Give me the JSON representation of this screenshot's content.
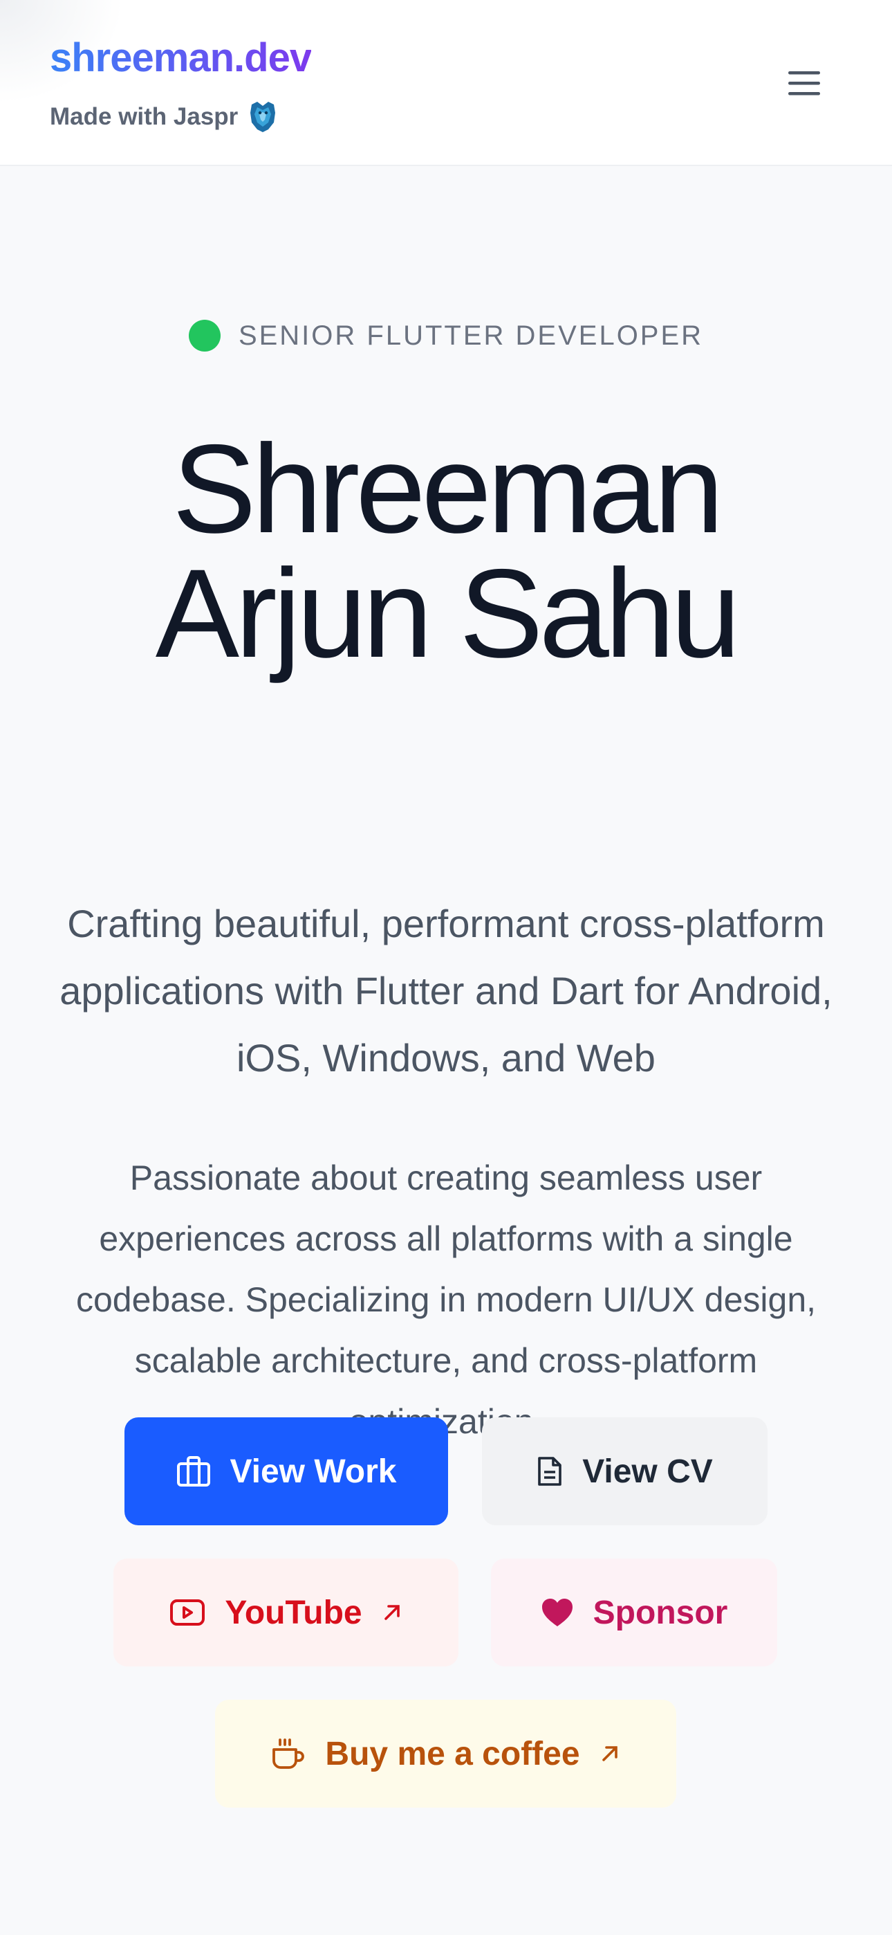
{
  "header": {
    "brand": "shreeman.dev",
    "made_with": "Made with Jaspr"
  },
  "hero": {
    "role": "SENIOR FLUTTER DEVELOPER",
    "name": "Shreeman Arjun Sahu",
    "tagline": "Crafting beautiful, performant cross-platform applications with Flutter and Dart for Android, iOS, Windows, and Web",
    "bio": "Passionate about creating seamless user experiences across all platforms with a single codebase. Specializing in modern UI/UX design, scalable architecture, and cross-platform optimization."
  },
  "actions": {
    "view_work": "View Work",
    "view_cv": "View CV",
    "youtube": "YouTube",
    "sponsor": "Sponsor",
    "coffee": "Buy me a coffee"
  },
  "colors": {
    "brand_gradient_start": "#3b82f6",
    "brand_gradient_end": "#7c3aed",
    "status_dot": "#22c55e",
    "primary_button": "#1a5cff",
    "youtube": "#d70f1c",
    "sponsor": "#c1175c",
    "coffee": "#b8520c"
  },
  "icons": {
    "menu": "hamburger-icon",
    "jaspr": "jaspr-logo-icon",
    "view_work": "briefcase-icon",
    "view_cv": "document-icon",
    "youtube": "youtube-icon",
    "external": "arrow-up-right-icon",
    "sponsor": "heart-icon",
    "coffee": "coffee-cup-icon"
  }
}
